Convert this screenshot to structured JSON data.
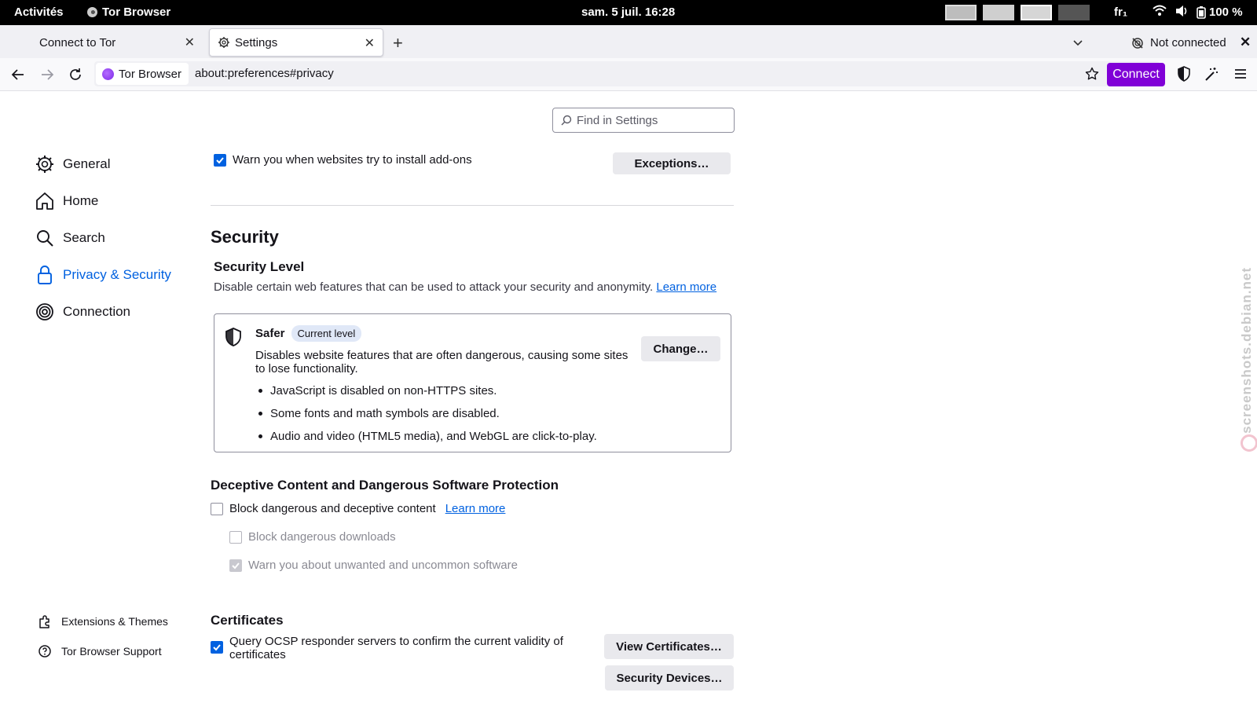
{
  "topbar": {
    "activities": "Activités",
    "app_name": "Tor Browser",
    "clock": "sam. 5 juil.  16:28",
    "keyboard": "fr₁",
    "battery": "100 %"
  },
  "tabs": [
    {
      "label": "Connect to Tor"
    },
    {
      "label": "Settings"
    }
  ],
  "tor_status": "Not connected",
  "navbar": {
    "identity": "Tor Browser",
    "url": "about:preferences#privacy",
    "connect_label": "Connect"
  },
  "search": {
    "placeholder": "Find in Settings"
  },
  "sidebar": {
    "items": [
      {
        "label": "General"
      },
      {
        "label": "Home"
      },
      {
        "label": "Search"
      },
      {
        "label": "Privacy & Security"
      },
      {
        "label": "Connection"
      }
    ],
    "footer": [
      {
        "label": "Extensions & Themes"
      },
      {
        "label": "Tor Browser Support"
      }
    ]
  },
  "addons": {
    "warn_label": "Warn you when websites try to install add-ons",
    "warn_checked": true,
    "exceptions_button": "Exceptions…"
  },
  "security": {
    "heading": "Security",
    "level_heading": "Security Level",
    "level_desc": "Disable certain web features that can be used to attack your security and anonymity.",
    "learn_more": "Learn more",
    "level_name": "Safer",
    "current_badge": "Current level",
    "level_summary_1": "Disables website features that are often dangerous, causing some sites",
    "level_summary_2": "to lose functionality.",
    "bullets": [
      "JavaScript is disabled on non-HTTPS sites.",
      "Some fonts and math symbols are disabled.",
      "Audio and video (HTML5 media), and WebGL are click-to-play."
    ],
    "change_button": "Change…"
  },
  "deceptive": {
    "heading": "Deceptive Content and Dangerous Software Protection",
    "block_label": "Block dangerous and deceptive content",
    "block_checked": false,
    "learn_more": "Learn more",
    "downloads_label": "Block dangerous downloads",
    "downloads_checked": false,
    "unwanted_label": "Warn you about unwanted and uncommon software",
    "unwanted_checked": true
  },
  "certificates": {
    "heading": "Certificates",
    "ocsp_label_1": "Query OCSP responder servers to confirm the current validity of",
    "ocsp_label_2": "certificates",
    "ocsp_checked": true,
    "view_button": "View Certificates…",
    "devices_button": "Security Devices…"
  },
  "watermark": "screenshots.debian.net"
}
